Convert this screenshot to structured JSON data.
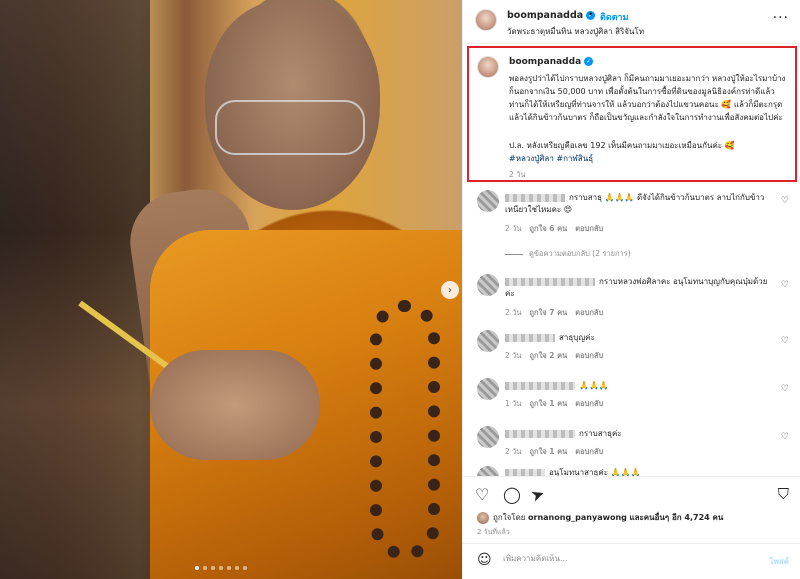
{
  "post": {
    "username": "boompanadda",
    "follow_label": "ติดตาม",
    "separator": "•",
    "location": "วัดพระธาตุหมื่นทิน หลวงปู่ศิลา สิริจันโท",
    "more_icon": "more-horizontal-icon",
    "verified_icon": "verified-badge-icon"
  },
  "caption": {
    "username": "boompanadda",
    "text": "พอลงรูปว่าได้ไปกราบหลวงปู่ศิลา ก็มีคนถามมาเยอะมากว่า หลวงปู่ให้อะไรมาบ้าง ก็นอกจากเงิน 50,000 บาท เพื่อตั้งต้นในการซื้อที่ดินของมูลนิธิองค์กรท่าดีแล้ว ท่านก็ได้ให้เหรียญที่ท่านจารให้ แล้วบอกว่าต้องไปแขวนคอนะ 🥰 แล้วก็มีตะกรุด แล้วได้กินข้าวก้นบาตร ก็ถือเป็นขวัญและกำลังใจในการทำงานเพื่อสังคมต่อไปค่ะ",
    "ps": "ป.ล. หลังเหรียญคือเลข 192 เห็นมีคนถามมาเยอะเหมือนกันค่ะ 🥰",
    "hashtags": "#หลวงปู่ศิลา #กาฬสินธุ์",
    "time": "2 วัน"
  },
  "comments": [
    {
      "text": "กราบสาธุ 🙏🙏🙏 ดีจังได้กินข้าวก้นบาตร ลาบไก่กับข้าวเหนียวใช่ไหมคะ 😍",
      "time": "2 วัน",
      "likes": "ถูกใจ 6 คน",
      "reply": "ตอบกลับ",
      "view_replies": "ดูข้อความตอบกลับ (2 รายการ)"
    },
    {
      "text": "กราบหลวงพ่อศิลาคะ อนุโมทนาบุญกับคุณบุ๋มด้วยค่ะ",
      "time": "2 วัน",
      "likes": "ถูกใจ 7 คน",
      "reply": "ตอบกลับ"
    },
    {
      "text": "สาธุบุญค่ะ",
      "time": "2 วัน",
      "likes": "ถูกใจ 2 คน",
      "reply": "ตอบกลับ"
    },
    {
      "text": "🙏🙏🙏",
      "time": "1 วัน",
      "likes": "ถูกใจ 1 คน",
      "reply": "ตอบกลับ"
    },
    {
      "text": "กราบสาธุค่ะ",
      "time": "2 วัน",
      "likes": "ถูกใจ 1 คน",
      "reply": "ตอบกลับ"
    },
    {
      "text": "อนุโมทนาสาธุค่ะ 🙏🙏🙏"
    }
  ],
  "actions": {
    "liked_by_prefix": "ถูกใจโดย",
    "liked_by_user": "ornanong_panyawong",
    "liked_by_suffix": "และคนอื่นๆ อีก 4,724 คน",
    "ago": "2 วันที่แล้ว",
    "comment_placeholder": "เพิ่มความคิดเห็น...",
    "post_label": "โพสต์"
  },
  "carousel": {
    "dot_count": 7,
    "active_index": 0
  }
}
